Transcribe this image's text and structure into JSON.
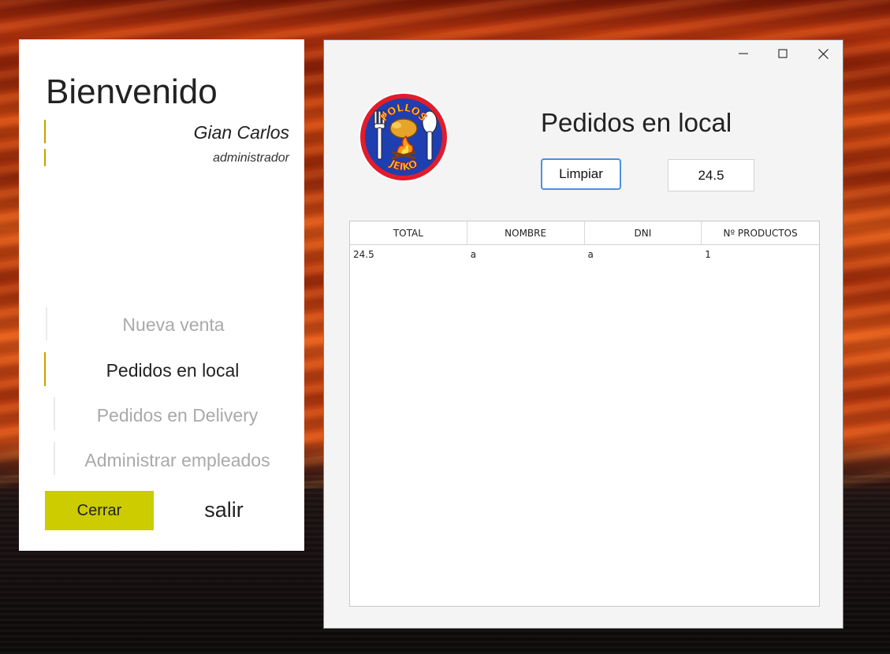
{
  "sidebar": {
    "welcome": "Bienvenido",
    "user_name": "Gian Carlos",
    "user_role": "administrador",
    "nav": [
      {
        "label": "Nueva venta",
        "active": false
      },
      {
        "label": "Pedidos en local",
        "active": true
      },
      {
        "label": "Pedidos en Delivery",
        "active": false
      },
      {
        "label": "Administrar empleados",
        "active": false
      }
    ],
    "close_label": "Cerrar",
    "exit_label": "salir"
  },
  "window": {
    "controls": {
      "minimize_icon": "minimize-icon",
      "maximize_icon": "maximize-icon",
      "close_icon": "close-icon"
    },
    "logo": {
      "top_text": "POLLOS",
      "bottom_text": "JEIKO"
    },
    "title": "Pedidos en local",
    "clear_label": "Limpiar",
    "total_value": "24.5",
    "table": {
      "columns": [
        "TOTAL",
        "NOMBRE",
        "DNI",
        "Nº PRODUCTOS"
      ],
      "rows": [
        [
          "24.5",
          "a",
          "a",
          "1"
        ]
      ]
    }
  },
  "colors": {
    "accent": "#c9a000",
    "close_button": "#cccc00",
    "focus_border": "#4a90e2"
  }
}
